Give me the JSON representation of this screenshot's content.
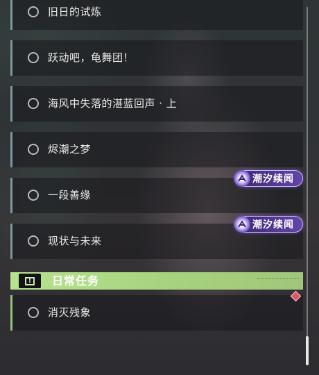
{
  "quests": [
    {
      "name": "旧日的试炼"
    },
    {
      "name": "跃动吧，龟舞团！"
    },
    {
      "name": "海风中失落的湛蓝回声 · 上"
    },
    {
      "name": "烬潮之梦"
    },
    {
      "name": "一段善缘",
      "badge": "潮汐续闻"
    },
    {
      "name": "现状与未来",
      "badge": "潮汐续闻"
    }
  ],
  "daily_section": {
    "title": "日常任务",
    "icon": "exclamation-box-icon",
    "quests": [
      {
        "name": "消灭残象"
      }
    ]
  },
  "colors": {
    "row_stripe": "#7e98a3",
    "daily_stripe": "#98c27a",
    "section_header": "#b8e38e",
    "badge_purple": "#6345a8",
    "marker": "#e05468"
  }
}
